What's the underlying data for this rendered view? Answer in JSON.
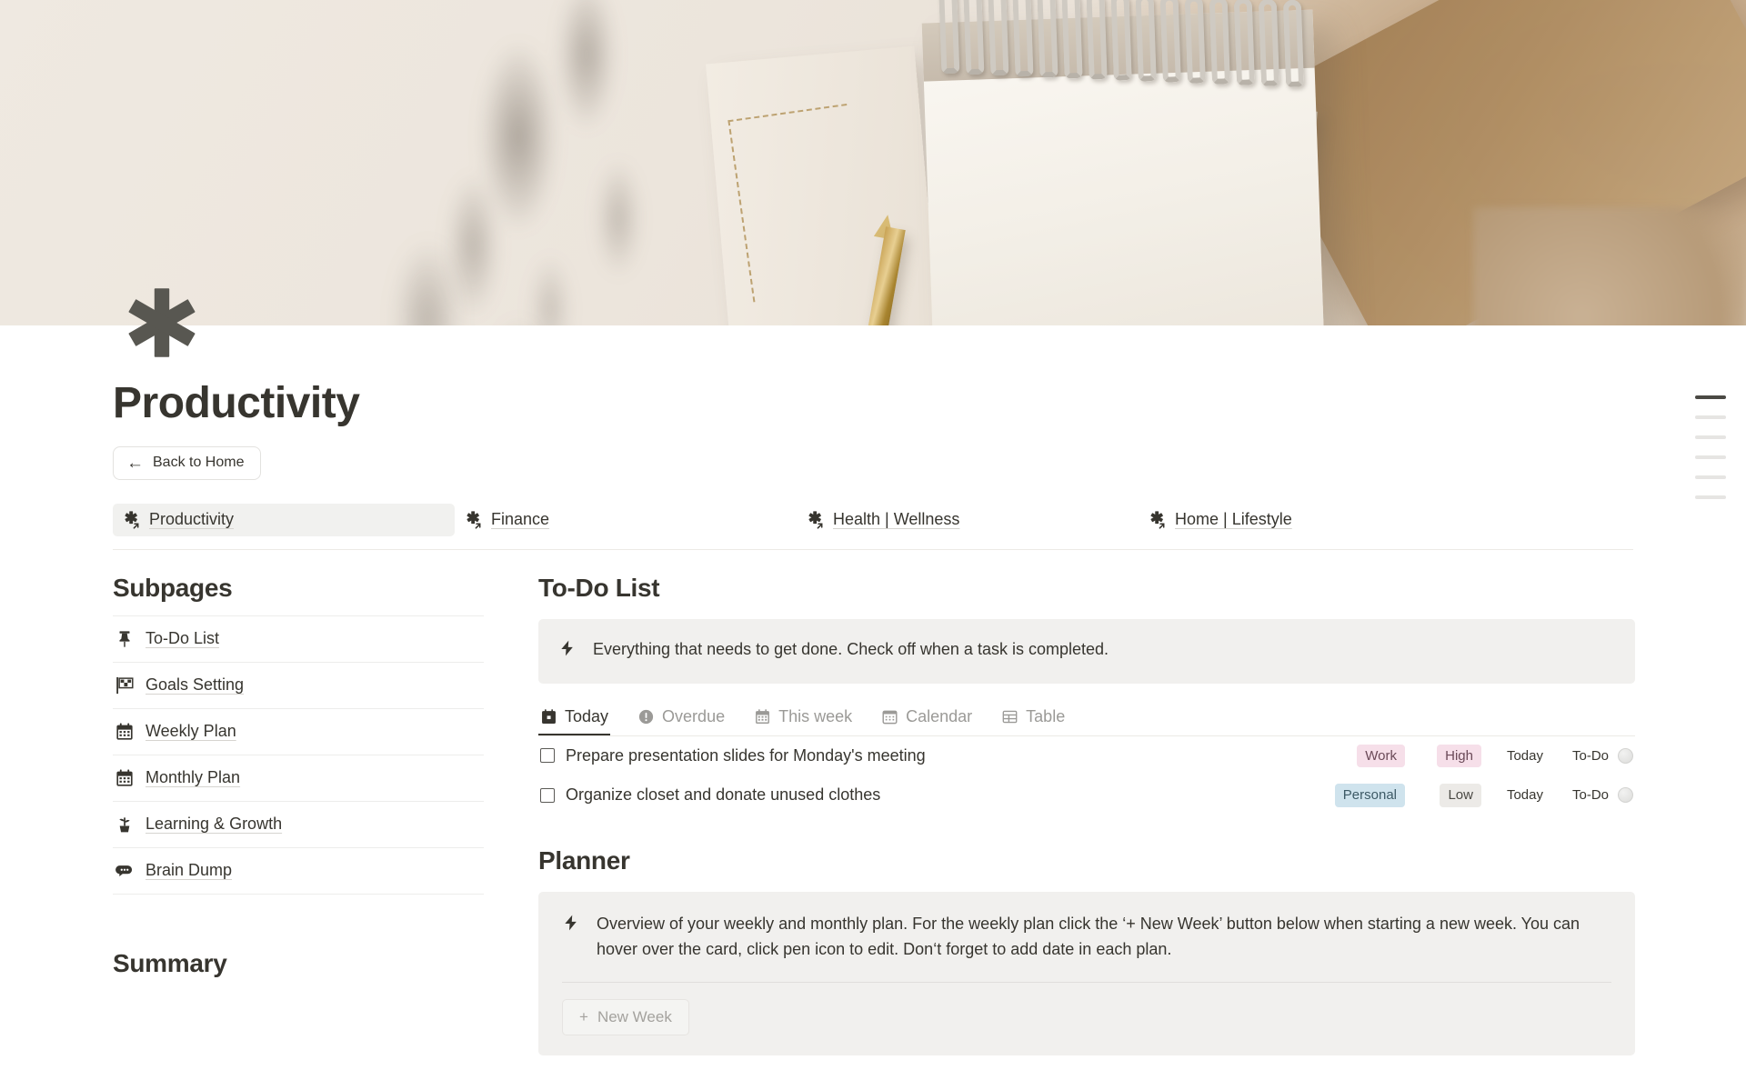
{
  "page": {
    "title": "Productivity",
    "icon": "asterisk-icon",
    "back_button": {
      "label": "Back to Home",
      "icon": "arrow-left-icon"
    }
  },
  "nav": {
    "items": [
      {
        "label": "Productivity",
        "icon": "asterisk-link-icon",
        "active": true
      },
      {
        "label": "Finance",
        "icon": "asterisk-link-icon",
        "active": false
      },
      {
        "label": "Health | Wellness",
        "icon": "asterisk-link-icon",
        "active": false
      },
      {
        "label": "Home | Lifestyle",
        "icon": "asterisk-link-icon",
        "active": false
      }
    ]
  },
  "subpages": {
    "heading": "Subpages",
    "items": [
      {
        "label": "To-Do List",
        "icon": "pushpin-icon"
      },
      {
        "label": "Goals Setting",
        "icon": "checkered-flag-icon"
      },
      {
        "label": "Weekly Plan",
        "icon": "calendar-icon"
      },
      {
        "label": "Monthly Plan",
        "icon": "calendar-icon"
      },
      {
        "label": "Learning & Growth",
        "icon": "seedling-icon"
      },
      {
        "label": "Brain Dump",
        "icon": "thought-bubble-icon"
      }
    ]
  },
  "summary": {
    "heading": "Summary"
  },
  "todo": {
    "heading": "To-Do List",
    "callout": "Everything that needs to get done. Check off when a task is completed.",
    "callout_icon": "lightning-bolt-icon",
    "tabs": [
      {
        "label": "Today",
        "icon": "day-calendar-icon",
        "active": true
      },
      {
        "label": "Overdue",
        "icon": "alert-circle-icon",
        "active": false
      },
      {
        "label": "This week",
        "icon": "calendar-icon",
        "active": false
      },
      {
        "label": "Calendar",
        "icon": "calendar-view-icon",
        "active": false
      },
      {
        "label": "Table",
        "icon": "table-icon",
        "active": false
      }
    ],
    "tasks": [
      {
        "name": "Prepare presentation slides for Monday's meeting",
        "checked": false,
        "tag": "Work",
        "tag_color": "#f6dfe9",
        "tag_text": "#6b4a58",
        "priority": "High",
        "priority_color": "#f6dfe9",
        "priority_text": "#6b4a58",
        "date": "Today",
        "status": "To-Do"
      },
      {
        "name": "Organize closet and donate unused clothes",
        "checked": false,
        "tag": "Personal",
        "tag_color": "#cfe3ed",
        "tag_text": "#3d5a66",
        "priority": "Low",
        "priority_color": "#eceae7",
        "priority_text": "#4a4944",
        "date": "Today",
        "status": "To-Do"
      }
    ]
  },
  "planner": {
    "heading": "Planner",
    "callout_icon": "lightning-bolt-icon",
    "callout": "Overview of your weekly and monthly plan. For the weekly plan click the ‘+ New Week’ button below when starting a new week. You can hover over the card, click pen icon to edit. Don‘t forget to add date in each plan.",
    "new_week_button": {
      "label": "New Week",
      "icon": "plus-icon"
    }
  },
  "toc": {
    "marks": [
      {
        "active": true
      },
      {
        "active": false
      },
      {
        "active": false
      },
      {
        "active": false
      },
      {
        "active": false
      },
      {
        "active": false
      }
    ]
  },
  "colors": {
    "text": "#37352f",
    "muted": "#9b9a97",
    "callout_bg": "#f1f0ee",
    "active_nav_bg": "#f1f1ef",
    "cover_base": "#e9e1d7"
  }
}
